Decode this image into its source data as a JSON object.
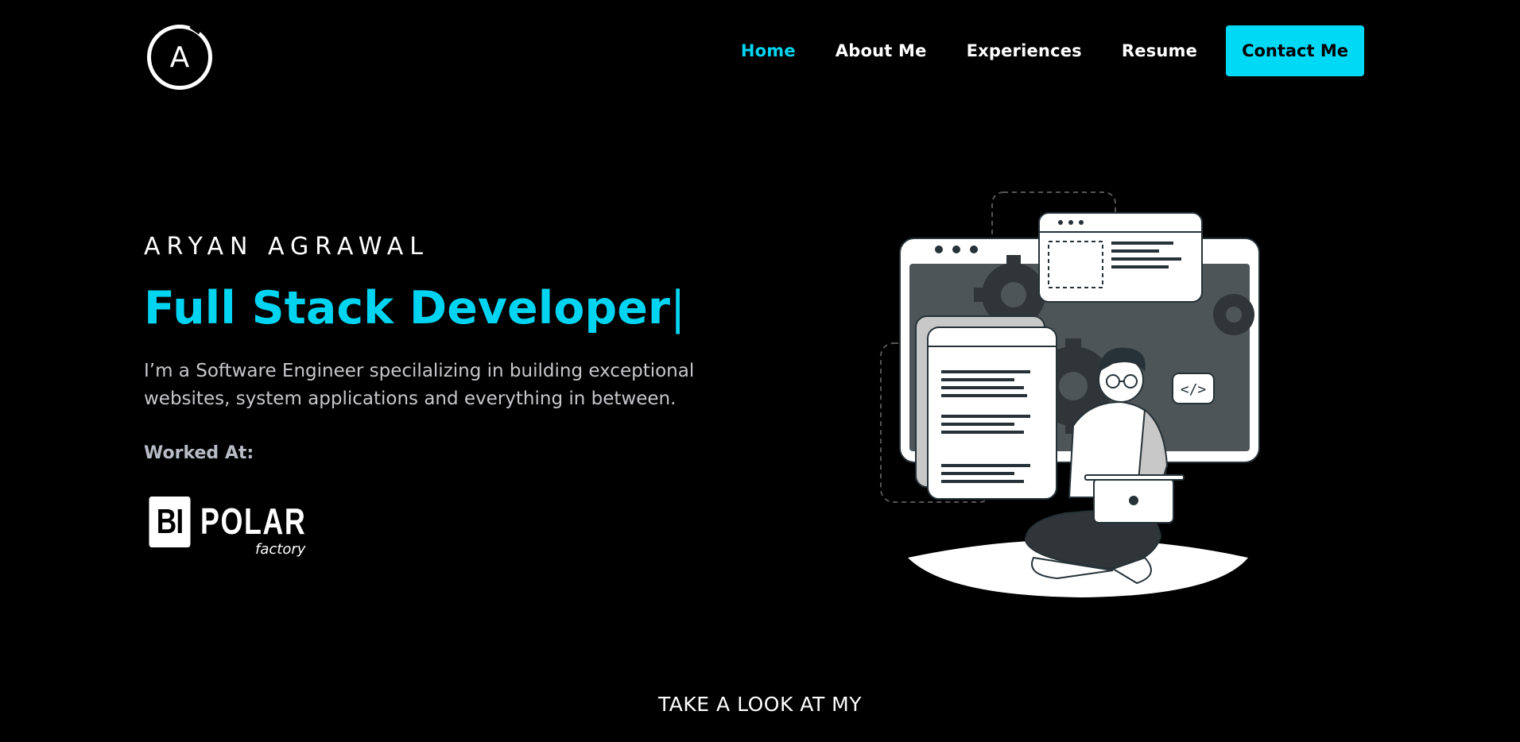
{
  "header": {
    "logo_letter": "A",
    "nav": [
      {
        "label": "Home",
        "active": true
      },
      {
        "label": "About Me",
        "active": false
      },
      {
        "label": "Experiences",
        "active": false
      },
      {
        "label": "Resume",
        "active": false
      }
    ],
    "contact_label": "Contact Me"
  },
  "hero": {
    "name": "ARYAN AGRAWAL",
    "role": "Full Stack Developer",
    "cursor": "|",
    "description": "I’m a Software Engineer specilalizing in building exceptional websites, system applications and everything in between.",
    "worked_at_label": "Worked At:",
    "company": {
      "mark": "BI",
      "name": "POLAR",
      "sub": "factory"
    },
    "illustration_code_tag": "</>"
  },
  "section": {
    "take_a_look": "TAKE A LOOK AT MY"
  },
  "colors": {
    "accent": "#00d4f0",
    "button": "#00d9f5",
    "background": "#000000"
  }
}
